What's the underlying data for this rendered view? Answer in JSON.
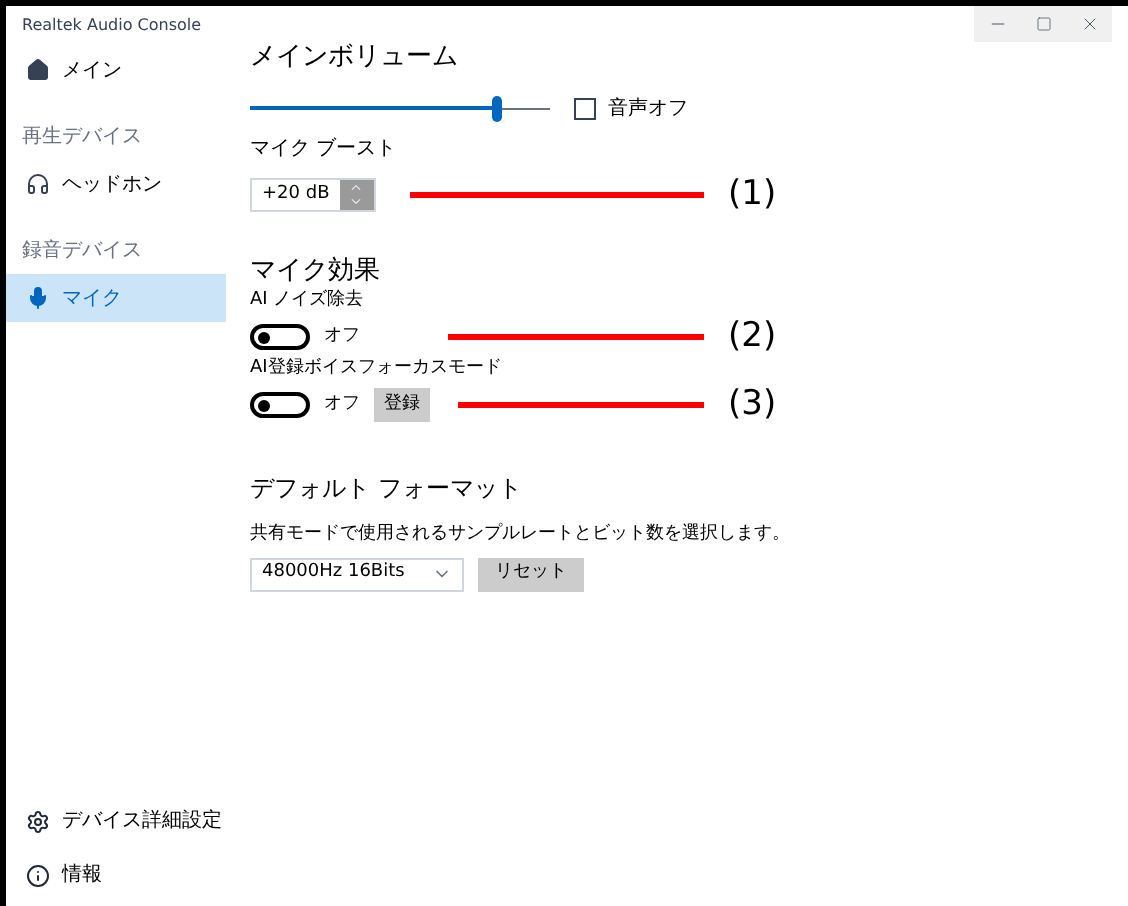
{
  "window": {
    "title": "Realtek Audio Console"
  },
  "sidebar": {
    "items": [
      {
        "kind": "nav",
        "label": "メイン",
        "selected": false
      },
      {
        "kind": "header",
        "label": "再生デバイス"
      },
      {
        "kind": "nav",
        "label": "ヘッドホン",
        "selected": false
      },
      {
        "kind": "header",
        "label": "録音デバイス"
      },
      {
        "kind": "nav",
        "label": "マイク",
        "selected": true
      }
    ],
    "footer_items": [
      {
        "label": "デバイス詳細設定"
      },
      {
        "label": "情報"
      }
    ]
  },
  "main_volume": {
    "title": "メインボリューム",
    "level": 0.82,
    "mute": {
      "label": "音声オフ",
      "checked": false
    }
  },
  "mic_boost": {
    "label": "マイク ブースト",
    "value": "+20 dB",
    "callout": "(1)"
  },
  "mic_effects": {
    "title": "マイク効果",
    "toggles": [
      {
        "label": "AI ノイズ除去",
        "on": false,
        "state_text": "オフ",
        "callout": "(2)"
      },
      {
        "label": "AI登録ボイスフォーカスモード",
        "on": false,
        "state_text": "オフ",
        "button": "登録",
        "callout": "(3)"
      }
    ]
  },
  "default_format": {
    "title": "デフォルト フォーマット",
    "description": "共有モードで使用されるサンプルレートとビット数を選択します。",
    "value": "48000Hz 16Bits",
    "reset": "リセット"
  }
}
